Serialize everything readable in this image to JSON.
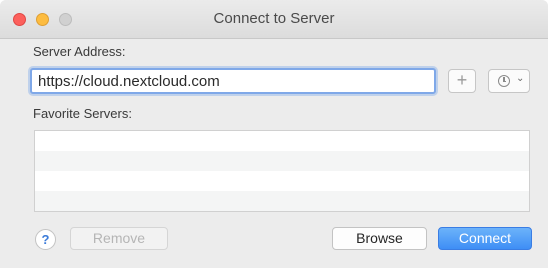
{
  "window": {
    "title": "Connect to Server"
  },
  "server_address": {
    "label": "Server Address:",
    "value": "https://cloud.nextcloud.com"
  },
  "toolbar": {
    "add_label": "+",
    "recent_chevron": "⌄"
  },
  "favorites": {
    "label": "Favorite Servers:",
    "items": []
  },
  "footer": {
    "help_label": "?",
    "remove_label": "Remove",
    "browse_label": "Browse",
    "connect_label": "Connect"
  },
  "icons": {
    "close": "close-icon",
    "minimize": "minimize-icon",
    "maximize": "maximize-icon",
    "add": "plus-icon",
    "recent": "clock-icon"
  },
  "colors": {
    "close": "#fc605c",
    "minimize": "#fdbc40",
    "maximize": "#d0d0d0",
    "accent": "#3e8ef5"
  }
}
